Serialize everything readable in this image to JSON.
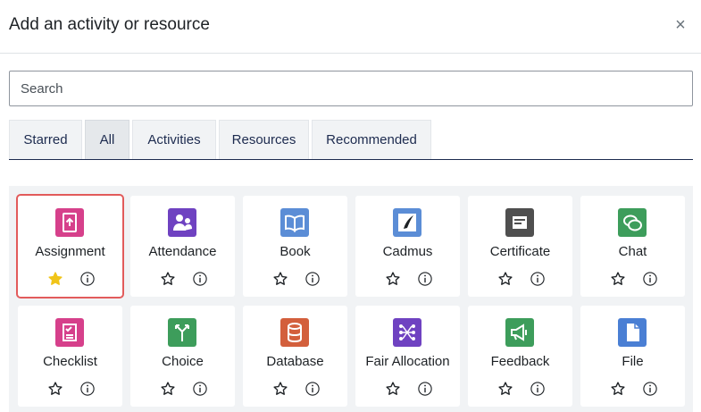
{
  "modal": {
    "title": "Add an activity or resource",
    "close_glyph": "×"
  },
  "search": {
    "placeholder": "Search",
    "value": ""
  },
  "tabs": [
    {
      "label": "Starred",
      "active": false
    },
    {
      "label": "All",
      "active": true
    },
    {
      "label": "Activities",
      "active": false
    },
    {
      "label": "Resources",
      "active": false
    },
    {
      "label": "Recommended",
      "active": false
    }
  ],
  "modules": [
    {
      "label": "Assignment",
      "icon": "assignment-icon",
      "color": "#d6408b",
      "starred": true,
      "highlighted": true
    },
    {
      "label": "Attendance",
      "icon": "attendance-icon",
      "color": "#6f42c1",
      "starred": false,
      "highlighted": false
    },
    {
      "label": "Book",
      "icon": "book-icon",
      "color": "#5b8dd6",
      "starred": false,
      "highlighted": false
    },
    {
      "label": "Cadmus",
      "icon": "cadmus-icon",
      "color": "#5b8dd6",
      "starred": false,
      "highlighted": false
    },
    {
      "label": "Certificate",
      "icon": "certificate-icon",
      "color": "#4f4f4f",
      "starred": false,
      "highlighted": false
    },
    {
      "label": "Chat",
      "icon": "chat-icon",
      "color": "#3d9d5b",
      "starred": false,
      "highlighted": false
    },
    {
      "label": "Checklist",
      "icon": "checklist-icon",
      "color": "#d6408b",
      "starred": false,
      "highlighted": false
    },
    {
      "label": "Choice",
      "icon": "choice-icon",
      "color": "#3d9d5b",
      "starred": false,
      "highlighted": false
    },
    {
      "label": "Database",
      "icon": "database-icon",
      "color": "#d35f3c",
      "starred": false,
      "highlighted": false
    },
    {
      "label": "Fair Allocation",
      "icon": "fair-allocation-icon",
      "color": "#6f42c1",
      "starred": false,
      "highlighted": false
    },
    {
      "label": "Feedback",
      "icon": "feedback-icon",
      "color": "#3d9d5b",
      "starred": false,
      "highlighted": false
    },
    {
      "label": "File",
      "icon": "file-icon",
      "color": "#4a7fd4",
      "starred": false,
      "highlighted": false
    }
  ],
  "colors": {
    "star_filled": "#f0c419",
    "star_outline": "#1d2125",
    "highlight_border": "#e25b5b",
    "tab_text": "#1d2b4f"
  }
}
